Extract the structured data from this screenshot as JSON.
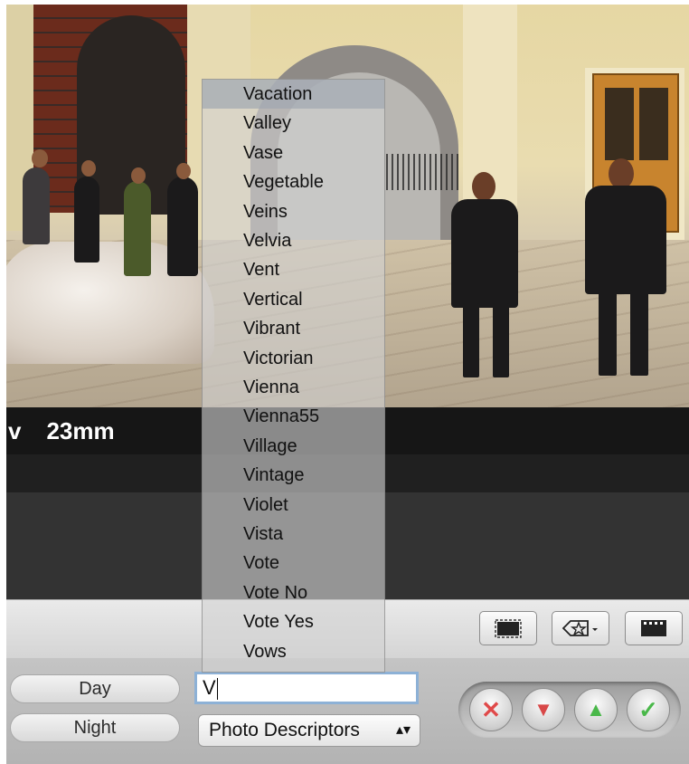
{
  "photo": {
    "focal_prefix": "v",
    "focal_length": "23mm"
  },
  "keyword_buttons": {
    "day": "Day",
    "night": "Night"
  },
  "keyword_input": {
    "value": "V"
  },
  "keyword_set_select": {
    "selected": "Photo Descriptors",
    "arrows": "▴▾"
  },
  "toolbar": {
    "icons": [
      "frame-icon",
      "keyword-badge-icon",
      "filmstrip-icon"
    ]
  },
  "nav_buttons": {
    "reject": "✕",
    "previous": "▼",
    "next": "▲",
    "approve": "✓"
  },
  "colors": {
    "reject": "#e04a4a",
    "previous": "#d84848",
    "next": "#4ab84a",
    "approve": "#4ab84a",
    "focus_ring": "#8db1d6"
  },
  "suggestions": [
    "Vacation",
    "Valley",
    "Vase",
    "Vegetable",
    "Veins",
    "Velvia",
    "Vent",
    "Vertical",
    "Vibrant",
    "Victorian",
    "Vienna",
    "Vienna55",
    "Village",
    "Vintage",
    "Violet",
    "Vista",
    "Vote",
    "Vote No",
    "Vote Yes",
    "Vows"
  ]
}
